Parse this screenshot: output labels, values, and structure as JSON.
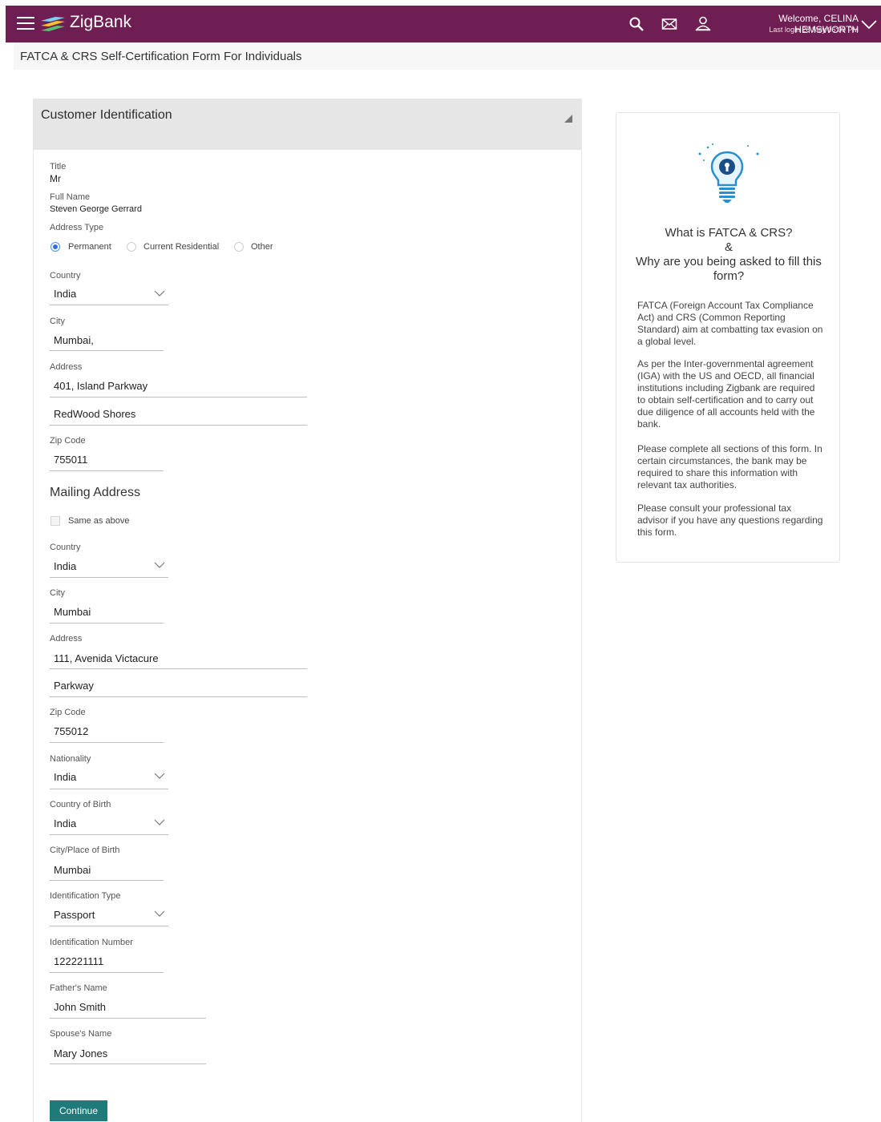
{
  "header": {
    "brand": "ZigBank",
    "welcome": "Welcome, CELINA HEMSWORTH",
    "last_login": "Last login 28 May 06:09 PM",
    "icons": [
      "menu-icon",
      "search-icon",
      "mail-icon",
      "user-icon",
      "chevron-down-icon"
    ],
    "bar_color": "#6e1e52"
  },
  "page": {
    "title": "FATCA & CRS Self-Certification Form For Individuals"
  },
  "form": {
    "section_title": "Customer Identification",
    "title_label": "Title",
    "title_value": "Mr",
    "full_name_label": "Full Name",
    "full_name_value": "Steven George Gerrard",
    "address_type_label": "Address Type",
    "address_type_options": [
      "Permanent",
      "Current Residential",
      "Other"
    ],
    "address_type_selected": "Permanent",
    "country_label": "Country",
    "country_value": "India",
    "city_label": "City",
    "city_value": "Mumbai,",
    "address_label": "Address",
    "address_line1": "401, Island Parkway",
    "address_line2": "RedWood Shores",
    "zip_label": "Zip Code",
    "zip_value": "755011",
    "mailing": {
      "title": "Mailing Address",
      "same_as_above_label": "Same as above",
      "same_as_above_checked": false,
      "country_label": "Country",
      "country_value": "India",
      "city_label": "City",
      "city_value": "Mumbai",
      "address_label": "Address",
      "address_line1": "111, Avenida Victacure",
      "address_line2": "Parkway",
      "zip_label": "Zip Code",
      "zip_value": "755012"
    },
    "nationality_label": "Nationality",
    "nationality_value": "India",
    "country_of_birth_label": "Country of Birth",
    "country_of_birth_value": "India",
    "city_of_birth_label": "City/Place of Birth",
    "city_of_birth_value": "Mumbai",
    "id_type_label": "Identification Type",
    "id_type_value": "Passport",
    "id_number_label": "Identification Number",
    "id_number_value": "122221111",
    "father_label": "Father's Name",
    "father_value": "John Smith",
    "spouse_label": "Spouse's Name",
    "spouse_value": "Mary Jones",
    "continue_label": "Continue",
    "button_color": "#1f7a7a"
  },
  "info": {
    "icon": "lightbulb-lock-icon",
    "heading_line1": "What is FATCA & CRS?",
    "heading_line2": "&",
    "heading_line3": "Why are you being asked to fill this form?",
    "para1": "FATCA (Foreign Account Tax Compliance Act) and CRS (Common Reporting Standard) aim at combatting tax evasion on a global level.",
    "para2": "As per the Inter-governmental agreement (IGA) with the US and OECD, all financial institutions including Zigbank are required to obtain self-certification and to carry out due diligence of all accounts held with the bank.",
    "para3": "Please complete all sections of this form. In certain circumstances, the bank may be required to share this information with relevant tax authorities.",
    "para4": "Please consult your professional tax advisor if you have any questions regarding this form."
  }
}
